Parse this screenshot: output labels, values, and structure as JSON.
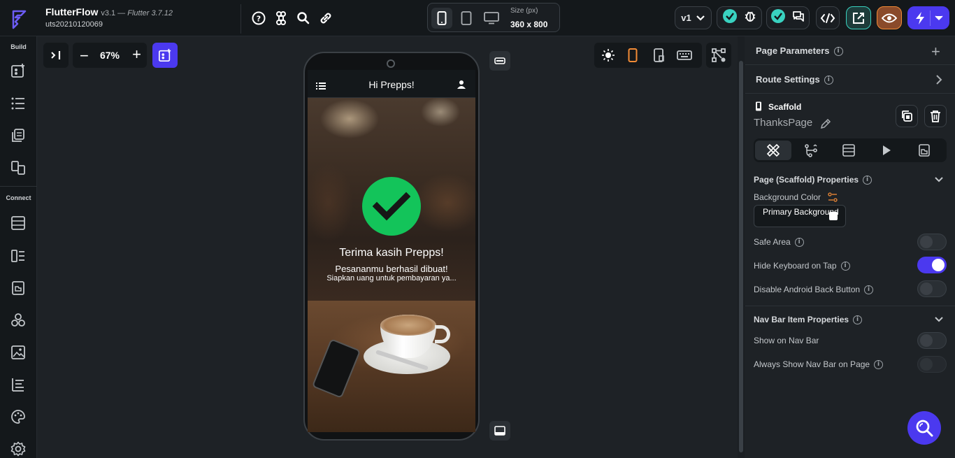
{
  "app": {
    "name": "FlutterFlow",
    "version": "v3.1 — ",
    "flutter_version": "Flutter 3.7.12",
    "project": "uts20210120069"
  },
  "toolbar": {
    "size_label": "Size (px)",
    "size_value": "360 x 800",
    "version_select": "v1"
  },
  "leftbar": {
    "build_label": "Build",
    "connect_label": "Connect"
  },
  "canvas": {
    "zoom": "67%"
  },
  "preview": {
    "appbar_title": "Hi Prepps!",
    "message_title": "Terima kasih Prepps!",
    "message_sub": "Pesananmu berhasil dibuat!",
    "message_note": "Siapkan uang untuk pembayaran ya..."
  },
  "panel": {
    "page_parameters": "Page Parameters",
    "route_settings": "Route Settings",
    "widget_type": "Scaffold",
    "page_name": "ThanksPage",
    "scaffold_section": "Page (Scaffold) Properties",
    "background_color_label": "Background Color",
    "background_color_value": "Primary Background",
    "safe_area": "Safe Area",
    "hide_keyboard": "Hide Keyboard on Tap",
    "disable_back": "Disable Android Back Button",
    "navbar_section": "Nav Bar Item Properties",
    "show_on_navbar": "Show on Nav Bar",
    "always_show_navbar": "Always Show Nav Bar on Page"
  },
  "colors": {
    "accent": "#4b39ef",
    "success": "#13c45a",
    "teal": "#39d2c0",
    "orange": "#f28b36"
  }
}
